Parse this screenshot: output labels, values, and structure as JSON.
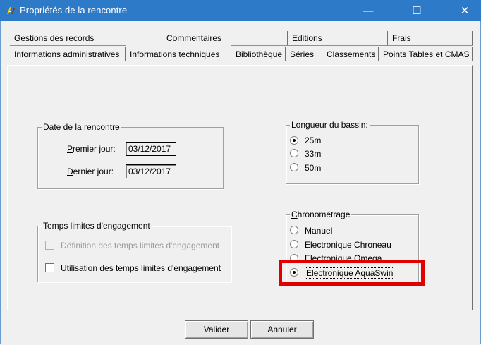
{
  "window": {
    "title": "Propriétés de la rencontre",
    "controls": {
      "minimize": "—",
      "maximize": "☐",
      "close": "✕"
    }
  },
  "tabs_row1": [
    "Gestions des records",
    "Commentaires",
    "Editions",
    "Frais"
  ],
  "tabs_row2": [
    "Informations administratives",
    "Informations techniques",
    "Bibliothèque",
    "Séries",
    "Classements",
    "Points Tables et CMAS"
  ],
  "selected_tab": "Informations techniques",
  "date_group": {
    "label": "Date de la rencontre",
    "first_day_label": "Premier jour:",
    "first_day_value": "03/12/2017",
    "last_day_label": "Dernier jour:",
    "last_day_value": "03/12/2017"
  },
  "pool_group": {
    "label": "Longueur du bassin:",
    "options": [
      "25m",
      "33m",
      "50m"
    ],
    "selected": "25m"
  },
  "limits_group": {
    "label": "Temps limites d'engagement",
    "definition_label": "Définition des temps limites d'engagement",
    "definition_checked": false,
    "definition_enabled": false,
    "usage_label": "Utilisation des temps limites d'engagement",
    "usage_checked": false
  },
  "timing_group": {
    "label": "Chronométrage",
    "options": [
      "Manuel",
      "Electronique Chroneau",
      "Electronique Omega",
      "Electronique AquaSwin"
    ],
    "selected": "Electronique AquaSwin"
  },
  "buttons": {
    "ok": "Valider",
    "cancel": "Annuler"
  },
  "colors": {
    "titlebar": "#2d7bc8",
    "highlight": "#e00000",
    "background": "#f0f0f0"
  }
}
